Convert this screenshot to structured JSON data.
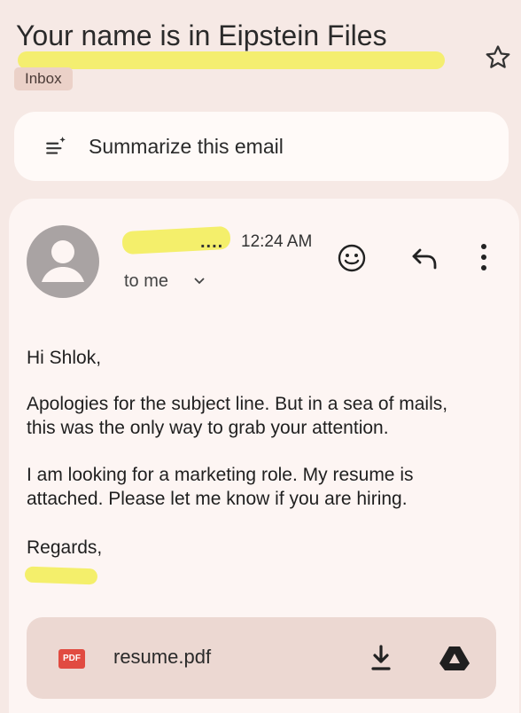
{
  "email": {
    "subject": "Your name is in Eipstein Files",
    "label": "Inbox"
  },
  "summarize": {
    "label": "Summarize this email"
  },
  "header": {
    "sender_trailing": "....",
    "time": "12:24 AM",
    "recipient": "to me"
  },
  "body": {
    "greeting": "Hi Shlok,",
    "para1_line1": "Apologies for the subject line. But in a sea of mails,",
    "para1_line2": "this was the only way to grab your attention.",
    "para2_line1": "I am looking for a marketing role. My resume is",
    "para2_line2": "attached. Please let me know if you are hiring.",
    "closing": "Regards,"
  },
  "attachment": {
    "badge": "PDF",
    "filename": "resume.pdf"
  },
  "icons": {
    "star": "star-icon",
    "sparkle": "summarize-sparkle-icon",
    "avatar": "person-avatar-icon",
    "emoji": "emoji-react-icon",
    "reply": "reply-icon",
    "more": "more-vert-icon",
    "download": "download-icon",
    "drive": "google-drive-icon"
  },
  "colors": {
    "background": "#f6e9e5",
    "highlight": "#f3ee5c",
    "chip": "#ebd1c8",
    "pdf_red": "#e14b41"
  }
}
